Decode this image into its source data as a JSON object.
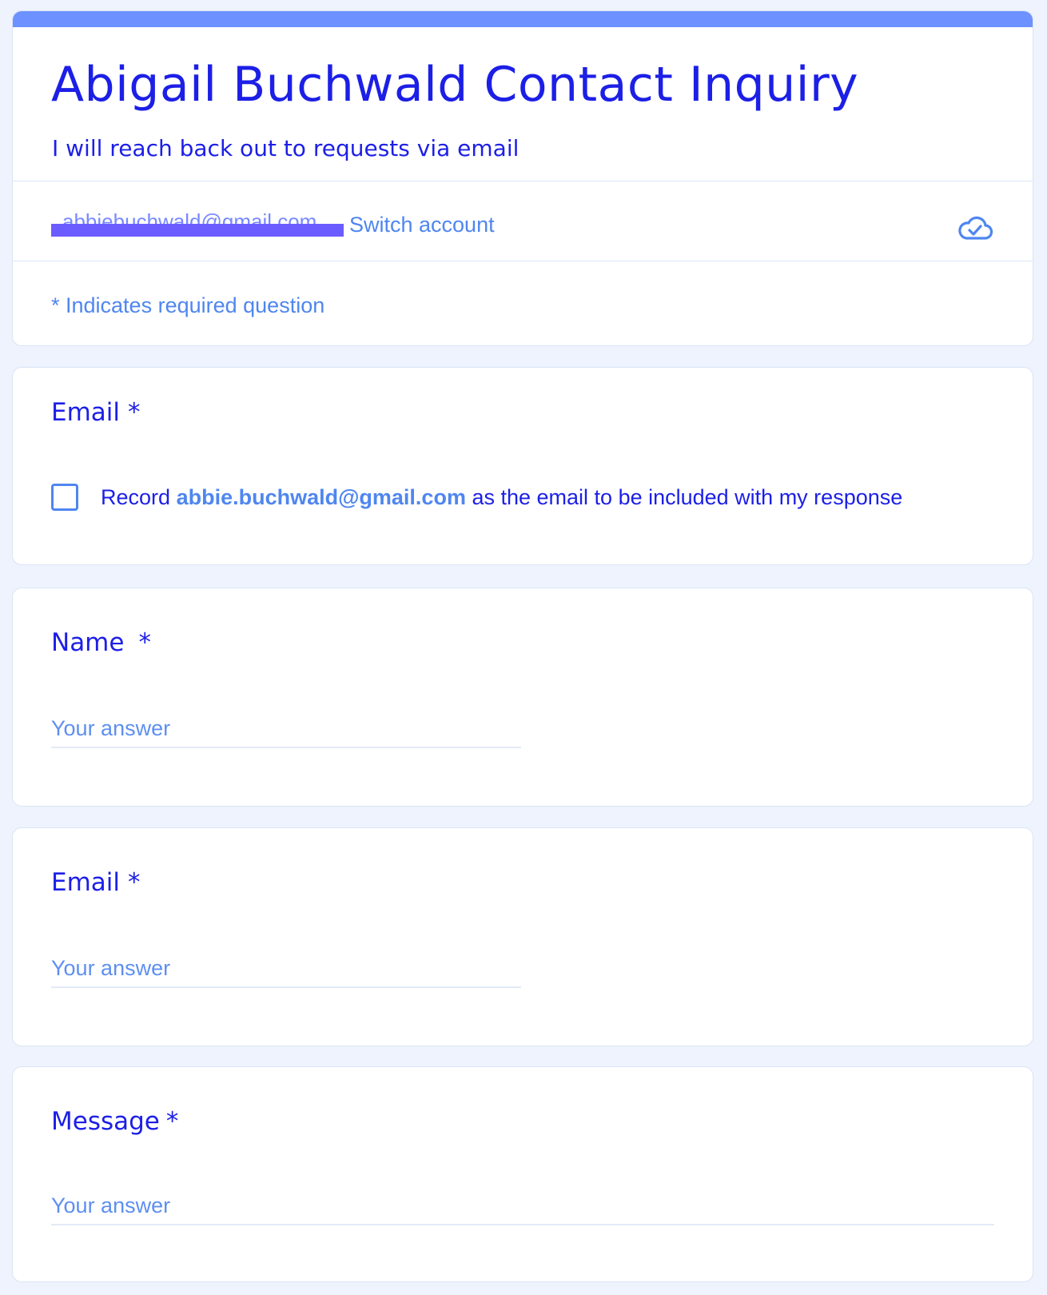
{
  "form": {
    "title": "Abigail Buchwald Contact Inquiry",
    "description": "I will reach back out to requests via email",
    "account_redacted_text": "abbiebuchwald@gmail.com",
    "switch_account": "Switch account",
    "saved_icon": "cloud-check-icon",
    "required_note": "* Indicates required question"
  },
  "questions": [
    {
      "title": "Email",
      "required_marker": "*",
      "type": "checkbox",
      "checked": false,
      "record_prefix": "Record",
      "record_email": "abbie.buchwald@gmail.com",
      "record_suffix": "as the email to be included with my response"
    },
    {
      "title": "Name",
      "required_marker": "*",
      "type": "short-answer",
      "value": "",
      "placeholder": "Your answer"
    },
    {
      "title": "Email",
      "required_marker": "*",
      "type": "short-answer",
      "value": "",
      "placeholder": "Your answer"
    },
    {
      "title": "Message",
      "required_marker": "*",
      "type": "paragraph",
      "value": "",
      "placeholder": "Your answer"
    }
  ],
  "colors": {
    "background": "#eef3fd",
    "accent_band": "#6d92ff",
    "title_text": "#1c1fe6",
    "link_text": "#4f86f0",
    "redaction_bar": "#6b5cff"
  }
}
